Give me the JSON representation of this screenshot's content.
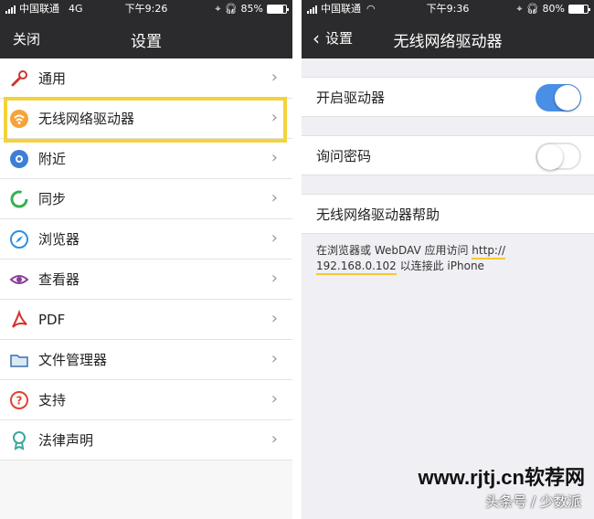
{
  "left": {
    "status": {
      "carrier": "中国联通",
      "network": "4G",
      "time": "下午9:26",
      "battery": "85%",
      "battery_level": 0.85
    },
    "nav": {
      "close_label": "关闭",
      "title": "设置"
    },
    "items": [
      {
        "label": "通用",
        "icon": "wrench-icon",
        "arrow": "›"
      },
      {
        "label": "无线网络驱动器",
        "icon": "wifi-icon",
        "arrow": "›"
      },
      {
        "label": "附近",
        "icon": "nearby-icon",
        "arrow": "›"
      },
      {
        "label": "同步",
        "icon": "sync-icon",
        "arrow": "›"
      },
      {
        "label": "浏览器",
        "icon": "compass-icon",
        "arrow": "›"
      },
      {
        "label": "查看器",
        "icon": "eye-icon",
        "arrow": "›"
      },
      {
        "label": "PDF",
        "icon": "pdf-icon",
        "arrow": "›"
      },
      {
        "label": "文件管理器",
        "icon": "folder-icon",
        "arrow": "›"
      },
      {
        "label": "支持",
        "icon": "question-icon",
        "arrow": "›"
      },
      {
        "label": "法律声明",
        "icon": "ribbon-icon",
        "arrow": "›"
      }
    ]
  },
  "right": {
    "status": {
      "carrier": "中国联通",
      "time": "下午9:36",
      "battery": "80%",
      "battery_level": 0.8
    },
    "nav": {
      "back_label": "设置",
      "back_chevron": "‹",
      "title": "无线网络驱动器"
    },
    "enable_driver": {
      "label": "开启驱动器",
      "on": true
    },
    "ask_password": {
      "label": "询问密码",
      "on": false
    },
    "help": {
      "label": "无线网络驱动器帮助"
    },
    "info": {
      "part1": "在浏览器或 WebDAV 应用访问 ",
      "url1": "http://",
      "url2": "192.168.0.102",
      "part2": " 以连接此 iPhone"
    }
  },
  "watermark": {
    "site": "www.rjtj.cn软荐网",
    "source": "头条号 / 少数派"
  },
  "colors": {
    "accent": "#4a8fe6",
    "highlight": "#f5d23b",
    "navbar": "#2b2b2d"
  }
}
